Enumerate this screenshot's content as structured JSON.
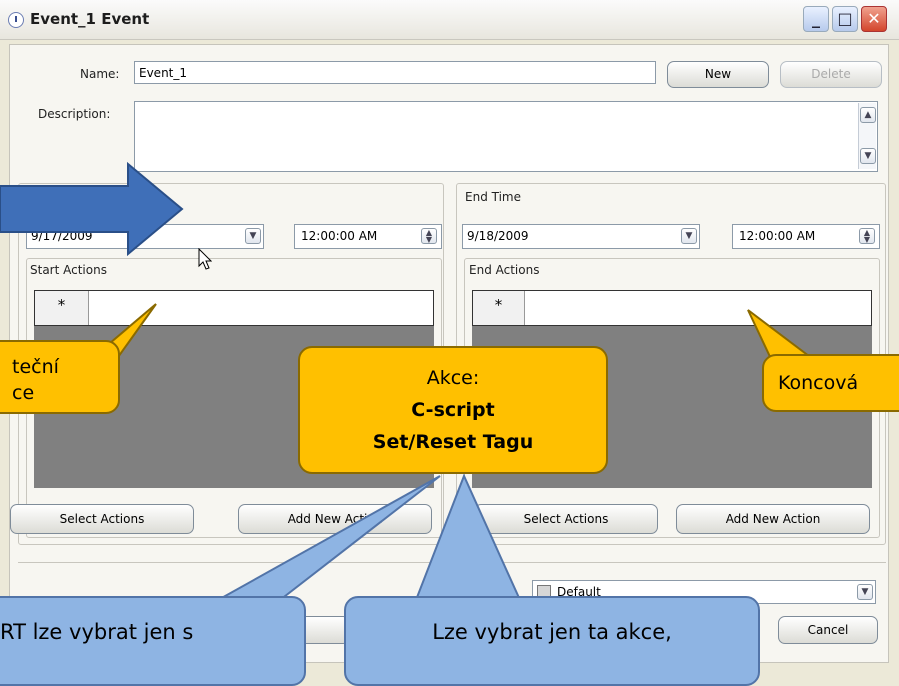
{
  "window": {
    "title": "Event_1 Event"
  },
  "form": {
    "name_label": "Name:",
    "name_value": "Event_1",
    "new_button": "New",
    "delete_button": "Delete",
    "description_label": "Description:"
  },
  "start": {
    "date": "9/17/2009",
    "time": "12:00:00 AM",
    "actions_title": "Start Actions",
    "select_button": "Select Actions",
    "add_button": "Add New Action"
  },
  "end": {
    "group_title": "End Time",
    "date": "9/18/2009",
    "time": "12:00:00 AM",
    "actions_title": "End Actions",
    "select_button": "Select Actions",
    "add_button": "Add New Action"
  },
  "grid": {
    "new_row_marker": "*"
  },
  "bottom": {
    "combo_value": "Default",
    "cancel_button": "Cancel"
  },
  "callouts": {
    "start_left_line1": "teční",
    "start_left_line2": "ce",
    "center_line1": "Akce:",
    "center_line2": "C-script",
    "center_line3": "Set/Reset Tagu",
    "end_right": "Koncová",
    "bottom_left_line1": "RT lze vybrat jen s",
    "bottom_center_line1": "Lze vybrat jen ta akce,"
  },
  "colors": {
    "callout_yellow": "#ffc000",
    "callout_blue": "#8eb4e3",
    "arrow_blue": "#3f6fb8"
  }
}
